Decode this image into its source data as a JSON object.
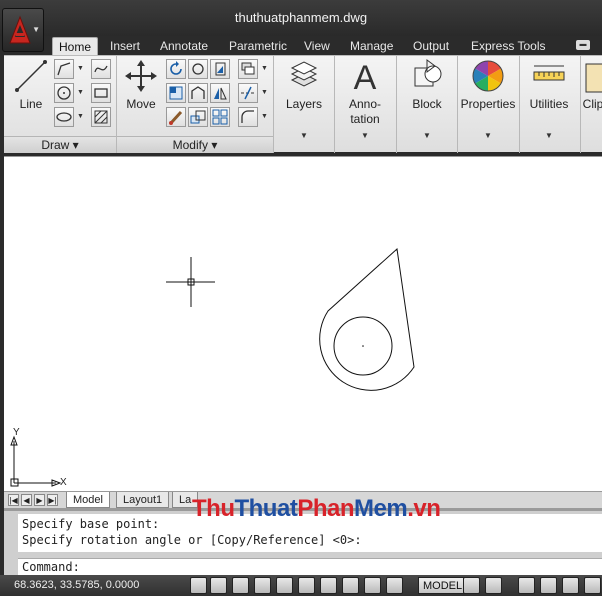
{
  "window": {
    "title": "thuthuatphanmem.dwg"
  },
  "tabs": [
    {
      "label": "Home",
      "active": true
    },
    {
      "label": "Insert"
    },
    {
      "label": "Annotate"
    },
    {
      "label": "Parametric"
    },
    {
      "label": "View"
    },
    {
      "label": "Manage"
    },
    {
      "label": "Output"
    },
    {
      "label": "Express Tools"
    }
  ],
  "ribbon": {
    "draw": {
      "title": "Draw",
      "line_label": "Line"
    },
    "modify": {
      "title": "Modify",
      "move_label": "Move"
    },
    "layers_label": "Layers",
    "annotation_label_1": "Anno-",
    "annotation_label_2": "tation",
    "block_label": "Block",
    "properties_label": "Properties",
    "utilities_label": "Utilities",
    "clipboard_label": "Clip"
  },
  "drawing": {
    "ucs_x": "X",
    "ucs_y": "Y"
  },
  "layout_tabs": [
    {
      "label": "Model",
      "active": true
    },
    {
      "label": "Layout1"
    },
    {
      "label": "La"
    }
  ],
  "command": {
    "line1": "Specify base point:",
    "line2": "Specify rotation angle or [Copy/Reference] <0>:",
    "prompt": "Command:"
  },
  "status": {
    "coords": "68.3623, 33.5785, 0.0000",
    "model_label": "MODEL"
  },
  "watermark": {
    "part1": "Thu",
    "part2": "Thuat",
    "part3": "Phan",
    "part4": "Mem",
    "part5": ".vn"
  },
  "colors": {
    "accent_red": "#d8232a",
    "accent_blue": "#1f4fa1",
    "dark_chrome": "#2b2b2b"
  }
}
